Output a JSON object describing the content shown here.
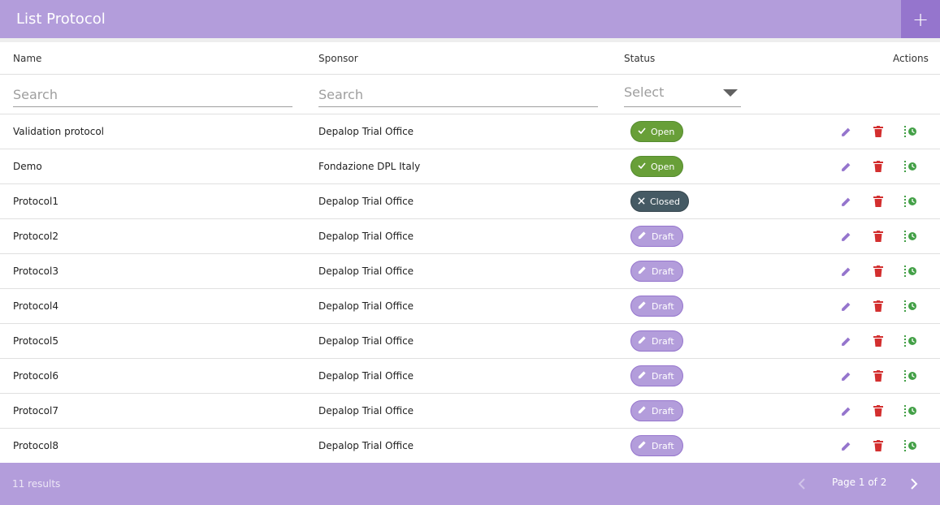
{
  "header": {
    "title": "List Protocol",
    "add_label": "+"
  },
  "columns": {
    "name": "Name",
    "sponsor": "Sponsor",
    "status": "Status",
    "actions": "Actions"
  },
  "filters": {
    "name_placeholder": "Search",
    "sponsor_placeholder": "Search",
    "status_placeholder": "Select"
  },
  "rows": [
    {
      "name": "Validation protocol",
      "sponsor": "Depalop Trial Office",
      "status": "Open",
      "status_icon": "check-icon"
    },
    {
      "name": "Demo",
      "sponsor": "Fondazione DPL Italy",
      "status": "Open",
      "status_icon": "check-icon"
    },
    {
      "name": "Protocol1",
      "sponsor": "Depalop Trial Office",
      "status": "Closed",
      "status_icon": "close-icon"
    },
    {
      "name": "Protocol2",
      "sponsor": "Depalop Trial Office",
      "status": "Draft",
      "status_icon": "pencil-icon"
    },
    {
      "name": "Protocol3",
      "sponsor": "Depalop Trial Office",
      "status": "Draft",
      "status_icon": "pencil-icon"
    },
    {
      "name": "Protocol4",
      "sponsor": "Depalop Trial Office",
      "status": "Draft",
      "status_icon": "pencil-icon"
    },
    {
      "name": "Protocol5",
      "sponsor": "Depalop Trial Office",
      "status": "Draft",
      "status_icon": "pencil-icon"
    },
    {
      "name": "Protocol6",
      "sponsor": "Depalop Trial Office",
      "status": "Draft",
      "status_icon": "pencil-icon"
    },
    {
      "name": "Protocol7",
      "sponsor": "Depalop Trial Office",
      "status": "Draft",
      "status_icon": "pencil-icon"
    },
    {
      "name": "Protocol8",
      "sponsor": "Depalop Trial Office",
      "status": "Draft",
      "status_icon": "pencil-icon"
    }
  ],
  "footer": {
    "results": "11 results",
    "page": "Page 1 of 2"
  },
  "colors": {
    "accent": "#b39ddb",
    "accent_dark": "#9575cd",
    "open": "#689f38",
    "closed": "#455a64",
    "delete": "#d32f2f",
    "history": "#43a047"
  }
}
